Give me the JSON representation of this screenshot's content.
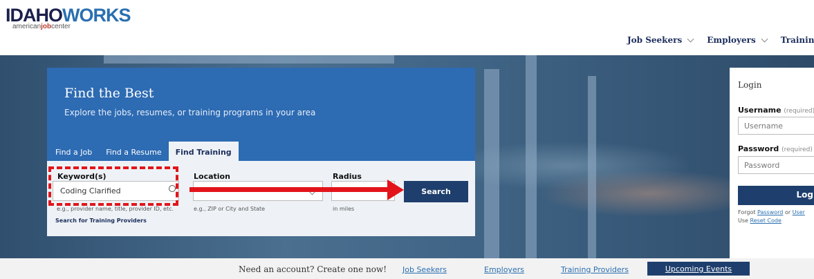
{
  "header": {
    "logo_idaho": "IDAHO",
    "logo_works": "WORKS",
    "logo_sub_pre": "american",
    "logo_sub_bold": "job",
    "logo_sub_post": "center",
    "nav": [
      {
        "label": "Job Seekers"
      },
      {
        "label": "Employers"
      },
      {
        "label": "Training Pr"
      }
    ]
  },
  "search": {
    "title": "Find the Best",
    "subtitle": "Explore the jobs, resumes, or training programs in your area",
    "tabs": [
      {
        "label": "Find a Job",
        "active": false
      },
      {
        "label": "Find a Resume",
        "active": false
      },
      {
        "label": "Find Training",
        "active": true
      }
    ],
    "keyword_label": "Keyword(s)",
    "keyword_value": "Coding Clarified",
    "keyword_hint": "e.g., provider name, title, provider ID, etc.",
    "location_label": "Location",
    "location_value": "",
    "location_hint": "e.g., ZIP or City and State",
    "radius_label": "Radius",
    "radius_value": "",
    "radius_hint": "in miles",
    "button": "Search",
    "training_link": "Search for Training Providers"
  },
  "login": {
    "title": "Login",
    "username_label": "Username",
    "username_req": "(required)",
    "username_placeholder": "Username",
    "password_label": "Password",
    "password_req": "(required)",
    "password_placeholder": "Password",
    "button": "Log",
    "forgot_pre": "Forgot",
    "forgot_password": "Password",
    "forgot_or": "or",
    "forgot_user": "User",
    "reset_pre": "Use",
    "reset_code": "Reset Code"
  },
  "footer": {
    "prompt": "Need an account? Create one now!",
    "links": [
      "Job Seekers",
      "Employers",
      "Training Providers"
    ],
    "events_button": "Upcoming Events"
  },
  "colors": {
    "panel_blue": "#2d6bb3",
    "dark_navy": "#1e3f6d",
    "annotation_red": "#e2141a"
  }
}
